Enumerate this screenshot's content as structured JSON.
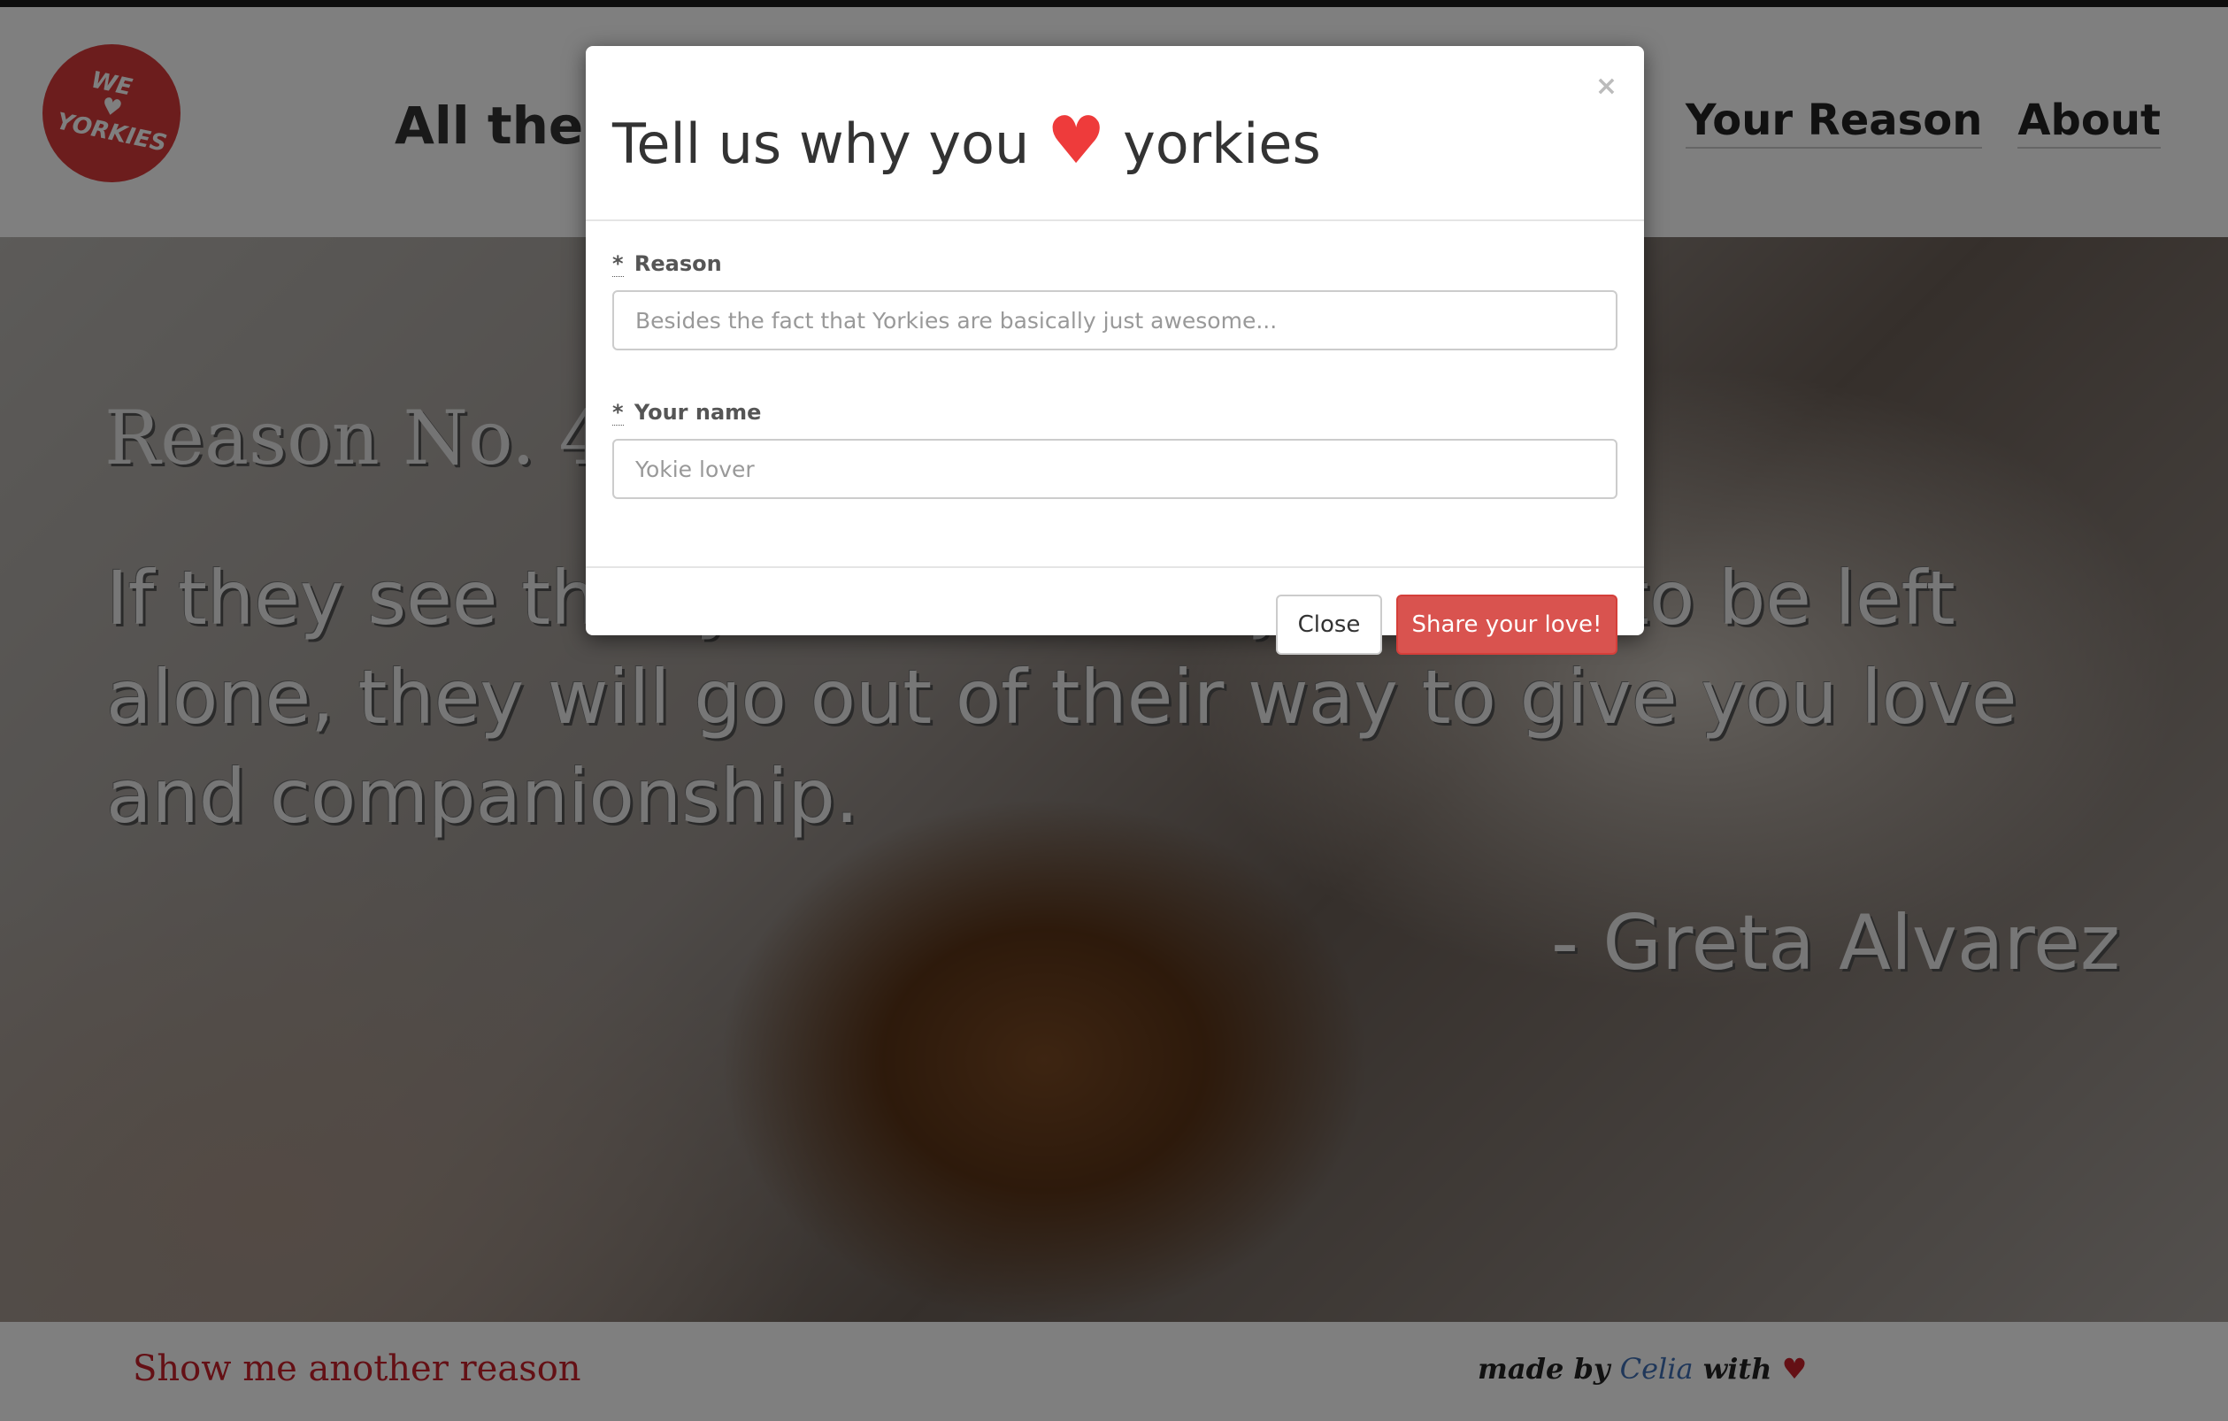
{
  "header": {
    "logo": {
      "line1": "WE",
      "heart": "♥",
      "line2": "YORKIES"
    },
    "nav_left": "All the",
    "nav_right": [
      {
        "label": "Your Reason"
      },
      {
        "label": "About"
      }
    ]
  },
  "hero": {
    "reason_label": "Reason No. 4 :",
    "quote": "If they see that you are sad or just want to be left alone, they will go out of their way to give you love and companionship.",
    "author": "- Greta Alvarez"
  },
  "footer": {
    "another_link": "Show me another reason",
    "made_by_prefix": "made by",
    "made_by_name": "Celia",
    "made_by_suffix": "with",
    "heart": "♥"
  },
  "modal": {
    "close_x": "×",
    "title_before": "Tell us why you",
    "title_heart": "♥",
    "title_after": "yorkies",
    "fields": [
      {
        "required_mark": "*",
        "label": "Reason",
        "placeholder": "Besides the fact that Yorkies are basically just awesome..."
      },
      {
        "required_mark": "*",
        "label": "Your name",
        "placeholder": "Yokie lover"
      }
    ],
    "close_button": "Close",
    "submit_button": "Share your love!"
  },
  "colors": {
    "accent": "#d9534f",
    "logo_bg": "#d83a3a",
    "heart": "#ee3b3b",
    "link_red": "#c8202a",
    "author_blue": "#3f6fb5"
  }
}
